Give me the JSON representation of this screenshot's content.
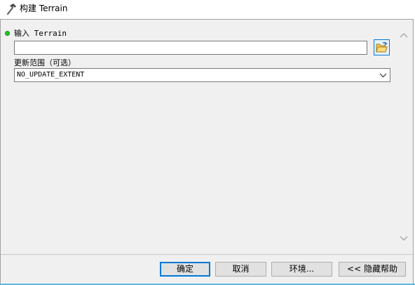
{
  "window": {
    "title": "构建 Terrain",
    "icon": "hammer-icon"
  },
  "params": {
    "input_terrain": {
      "label": "输入 Terrain",
      "value": "",
      "required": true,
      "required_color": "#21c621",
      "browse_icon": "folder-open-icon"
    },
    "update_extent": {
      "label": "更新范围（可选）",
      "value": "NO_UPDATE_EXTENT",
      "dropdown_icon": "chevron-down-icon"
    }
  },
  "scrollbar": {
    "up_icon": "chevron-up-icon",
    "down_icon": "chevron-down-icon"
  },
  "buttons": {
    "ok": "确定",
    "cancel": "取消",
    "environments": "环境...",
    "hide_help": "<< 隐藏帮助"
  },
  "colors": {
    "focus_border": "#0078d7",
    "accent": "#5db8e6"
  }
}
